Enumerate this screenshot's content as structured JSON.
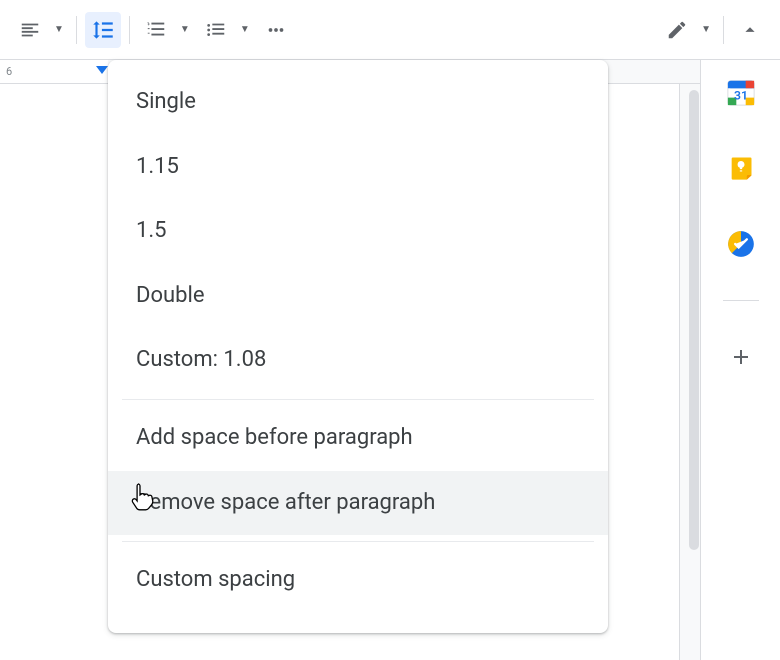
{
  "toolbar": {
    "align_label": "Align",
    "line_spacing_label": "Line & paragraph spacing",
    "numbered_list_label": "Numbered list",
    "bulleted_list_label": "Bulleted list",
    "more_label": "More",
    "editing_label": "Editing mode",
    "collapse_label": "Collapse"
  },
  "ruler": {
    "num": "6"
  },
  "menu": {
    "items": [
      {
        "label": "Single"
      },
      {
        "label": "1.15"
      },
      {
        "label": "1.5"
      },
      {
        "label": "Double"
      },
      {
        "label": "Custom: 1.08"
      }
    ],
    "add_before": "Add space before paragraph",
    "remove_after": "Remove space after paragraph",
    "custom_spacing": "Custom spacing"
  },
  "sidepanel": {
    "calendar": "Calendar",
    "keep": "Keep",
    "tasks": "Tasks",
    "add": "Get Add-ons"
  }
}
